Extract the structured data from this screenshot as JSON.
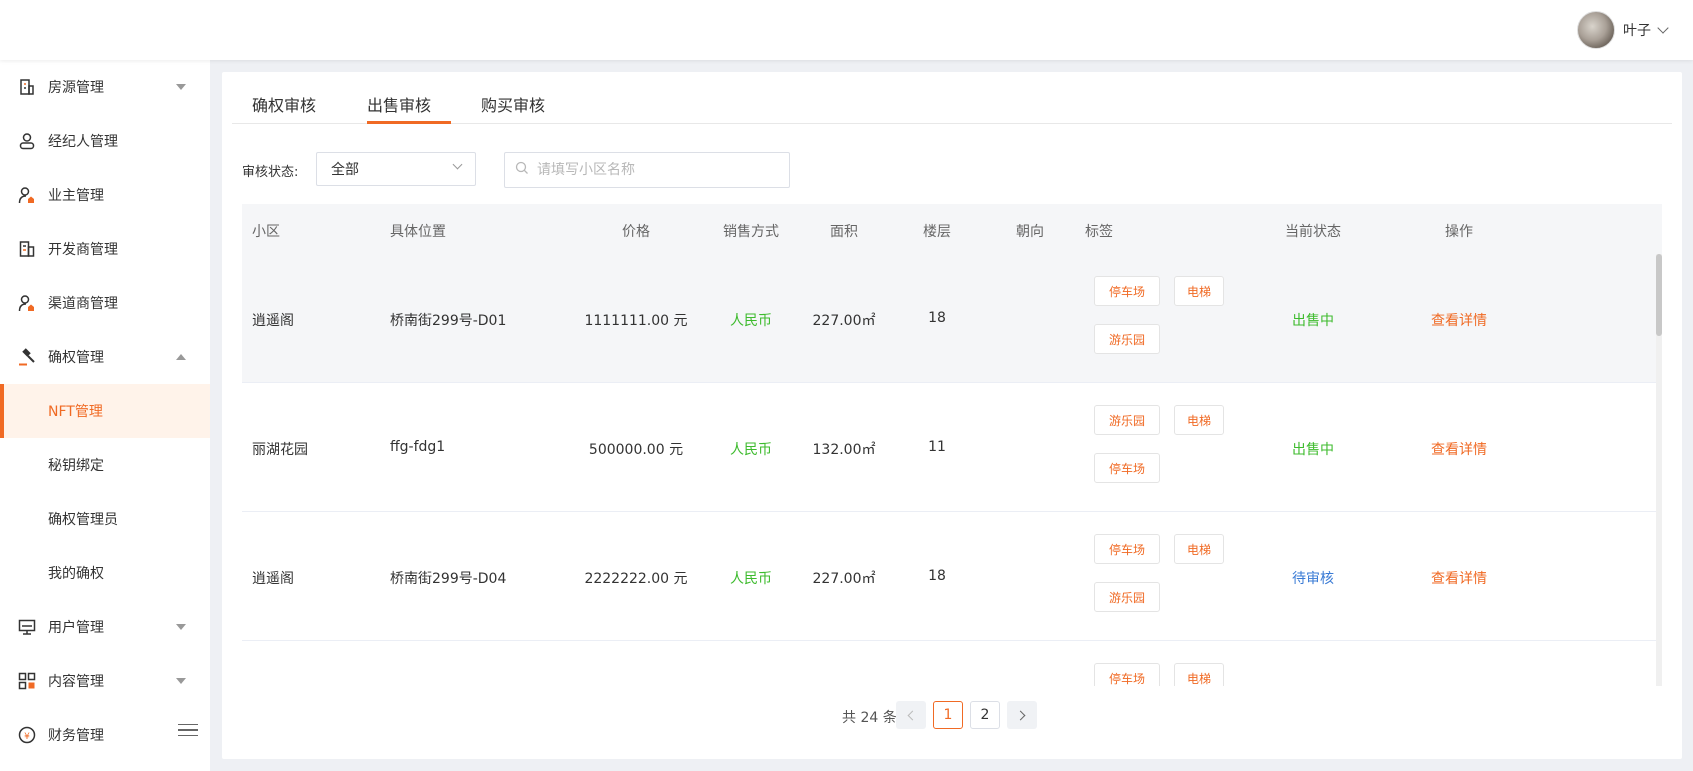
{
  "header": {
    "user_name": "叶子"
  },
  "sidebar": {
    "items": [
      {
        "label": "房源管理",
        "icon": "building-icon"
      },
      {
        "label": "经纪人管理",
        "icon": "person-icon"
      },
      {
        "label": "业主管理",
        "icon": "owner-icon"
      },
      {
        "label": "开发商管理",
        "icon": "developer-icon"
      },
      {
        "label": "渠道商管理",
        "icon": "channel-icon"
      },
      {
        "label": "确权管理",
        "icon": "gavel-icon"
      },
      {
        "label": "用户管理",
        "icon": "monitor-icon"
      },
      {
        "label": "内容管理",
        "icon": "grid-icon"
      },
      {
        "label": "财务管理",
        "icon": "yen-coin-icon"
      }
    ],
    "sub_items": [
      "NFT管理",
      "秘钥绑定",
      "确权管理员",
      "我的确权"
    ]
  },
  "tabs": [
    "确权审核",
    "出售审核",
    "购买审核"
  ],
  "filter": {
    "status_label": "审核状态:",
    "status_value": "全部",
    "search_placeholder": "请填写小区名称"
  },
  "table": {
    "headers": [
      "小区",
      "具体位置",
      "价格",
      "销售方式",
      "面积",
      "楼层",
      "朝向",
      "标签",
      "当前状态",
      "操作"
    ],
    "rows": [
      {
        "community": "逍遥阁",
        "location": "桥南街299号-D01",
        "price": "1111111.00 元",
        "method": "人民币",
        "area": "227.00㎡",
        "floor": "18",
        "orientation": "",
        "tags": [
          "停车场",
          "电梯",
          "游乐园"
        ],
        "status": "出售中",
        "action": "查看详情"
      },
      {
        "community": "丽湖花园",
        "location": "ffg-fdg1",
        "price": "500000.00 元",
        "method": "人民币",
        "area": "132.00㎡",
        "floor": "11",
        "orientation": "",
        "tags": [
          "游乐园",
          "电梯",
          "停车场"
        ],
        "status": "出售中",
        "action": "查看详情"
      },
      {
        "community": "逍遥阁",
        "location": "桥南街299号-D04",
        "price": "2222222.00 元",
        "method": "人民币",
        "area": "227.00㎡",
        "floor": "18",
        "orientation": "",
        "tags": [
          "停车场",
          "电梯",
          "游乐园"
        ],
        "status": "待审核",
        "action": "查看详情"
      },
      {
        "community": "",
        "location": "",
        "price": "",
        "method": "",
        "area": "",
        "floor": "",
        "orientation": "",
        "tags": [
          "停车场",
          "电梯"
        ],
        "status": "",
        "action": ""
      }
    ]
  },
  "pagination": {
    "total": "共 24 条",
    "pages": [
      "1",
      "2"
    ],
    "current": "1"
  },
  "colors": {
    "accent": "#f06a24",
    "selling": "#3dbb2d",
    "pending": "#3a7bd5"
  }
}
